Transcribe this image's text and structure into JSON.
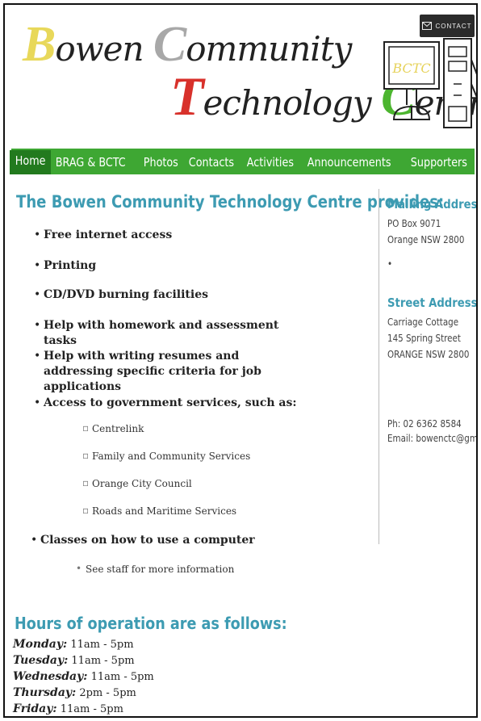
{
  "header": {
    "logo_line1": [
      {
        "cap": "B",
        "rest": "owen "
      },
      {
        "cap": "C",
        "rest": "ommunity"
      }
    ],
    "logo_line2": [
      {
        "cap": "T",
        "rest": "echnology "
      },
      {
        "cap": "C",
        "rest": "entre"
      }
    ],
    "logo_colors": {
      "b": "#e8d85a",
      "c1": "#a8a8a8",
      "t": "#d8312b",
      "c2": "#4cb52f"
    },
    "contact_label": "CONTACT",
    "contact_icon": "envelope-icon",
    "monitor_label": "BCTC"
  },
  "nav": {
    "items": [
      "Home",
      "BRAG & BCTC",
      "Photos",
      "Contacts",
      "Activities",
      "Announcements",
      "Supporters"
    ],
    "active": "Home",
    "color": "#3ea733",
    "active_color": "#227a1e"
  },
  "main": {
    "title": "The Bowen Community Technology Centre provides:",
    "services": [
      "Free internet access",
      "Printing",
      "CD/DVD burning facilities",
      "Help with homework and assessment tasks",
      "Help with writing resumes and addressing specific criteria for job applications",
      "Access to government services, such as:",
      "Classes on how to use a computer"
    ],
    "government_services": [
      "Centrelink",
      "Family and Community Services",
      "Orange City Council",
      "Roads and Maritime Services"
    ],
    "classes_note": "See staff for more information"
  },
  "hours": {
    "title": "Hours of operation are as follows:",
    "days": [
      {
        "day": "Monday:",
        "time": "11am - 5pm"
      },
      {
        "day": "Tuesday:",
        "time": "11am - 5pm"
      },
      {
        "day": "Wednesday:",
        "time": "11am - 5pm"
      },
      {
        "day": "Thursday:",
        "time": "2pm - 5pm"
      },
      {
        "day": "Friday:",
        "time": "11am - 5pm"
      }
    ]
  },
  "sidebar": {
    "mailing_title": "Mailing Address",
    "mailing_lines": [
      "PO Box 9071",
      "Orange NSW 2800"
    ],
    "mailing_extra": "•",
    "street_title": "Street Address",
    "street_lines": [
      "Carriage Cottage",
      "145 Spring Street",
      "ORANGE NSW 2800"
    ],
    "phone": "Ph: 02 6362 8584",
    "email": "Email: bowenctc@gmail.com"
  },
  "accent_color": "#3d9bb2"
}
